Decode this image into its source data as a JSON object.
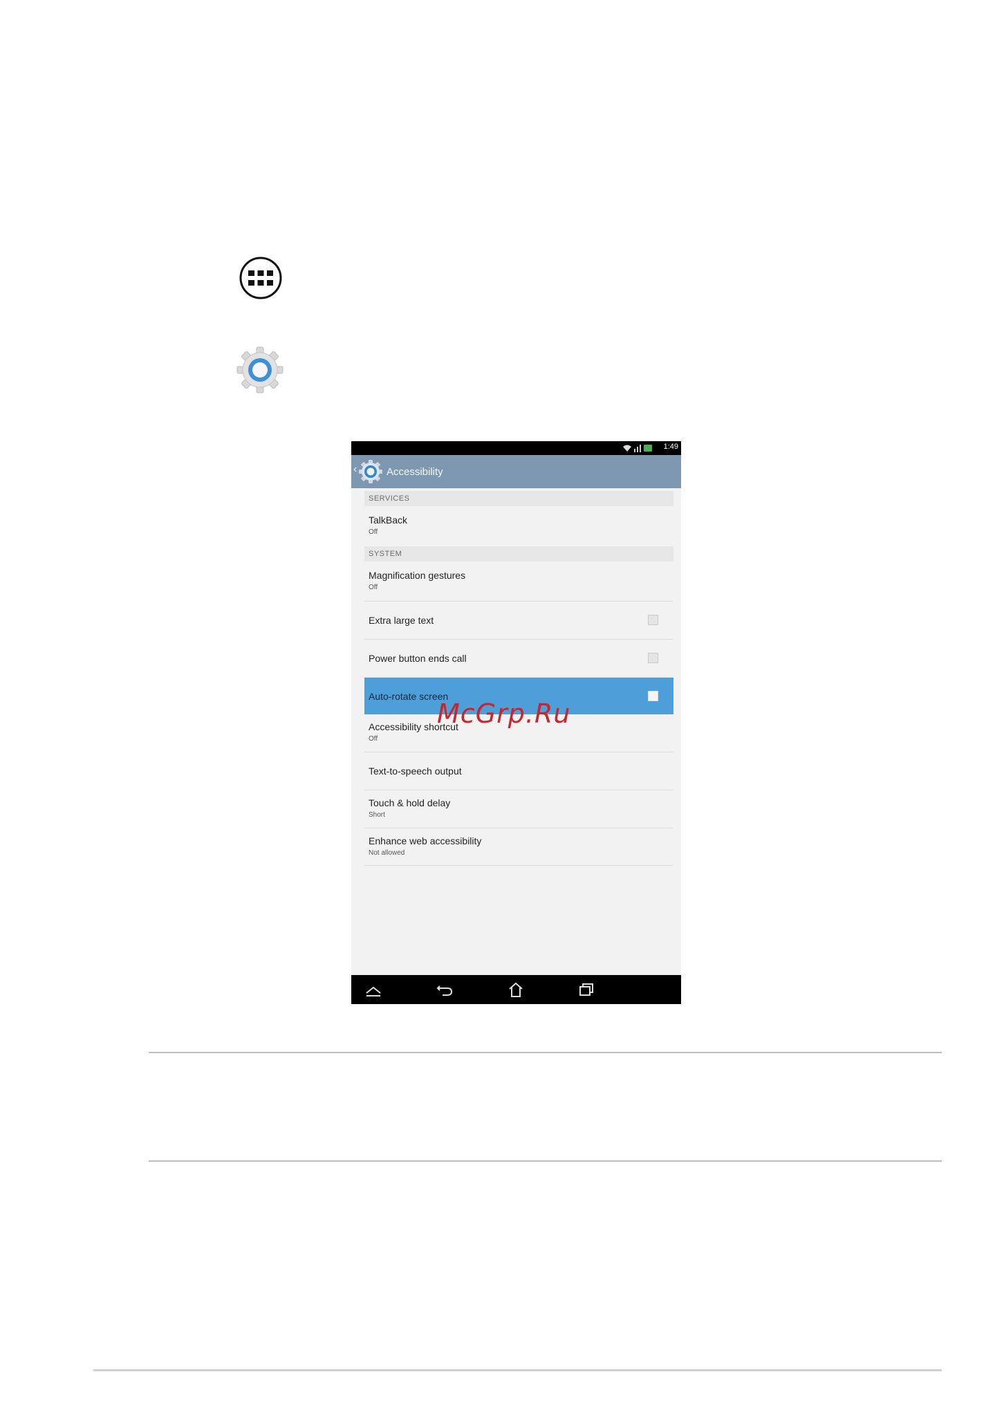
{
  "phone": {
    "status_time": "1:49",
    "title": "Accessibility",
    "sections": {
      "services": "SERVICES",
      "system": "SYSTEM"
    },
    "items": {
      "talkback": {
        "title": "TalkBack",
        "summary": "Off"
      },
      "magnification": {
        "title": "Magnification gestures",
        "summary": "Off"
      },
      "extra_large_text": {
        "title": "Extra large text",
        "checked": false
      },
      "power_button": {
        "title": "Power button ends call",
        "checked": false
      },
      "auto_rotate": {
        "title": "Auto-rotate screen",
        "checked": false,
        "selected": true
      },
      "shortcut": {
        "title": "Accessibility shortcut",
        "summary": "Off"
      },
      "tts": {
        "title": "Text-to-speech output"
      },
      "touch_hold": {
        "title": "Touch & hold delay",
        "summary": "Short"
      },
      "web_access": {
        "title": "Enhance web accessibility",
        "summary": "Not allowed"
      }
    }
  },
  "watermark": "McGrp.Ru",
  "colors": {
    "actionbar": "#7d98b0",
    "selected_row": "#4e9fd9",
    "watermark": "#c8262c"
  },
  "icons": [
    "apps-icon",
    "settings-icon",
    "back-arrow-icon",
    "navbar-up-icon",
    "navbar-back-icon",
    "navbar-home-icon",
    "navbar-recents-icon"
  ]
}
